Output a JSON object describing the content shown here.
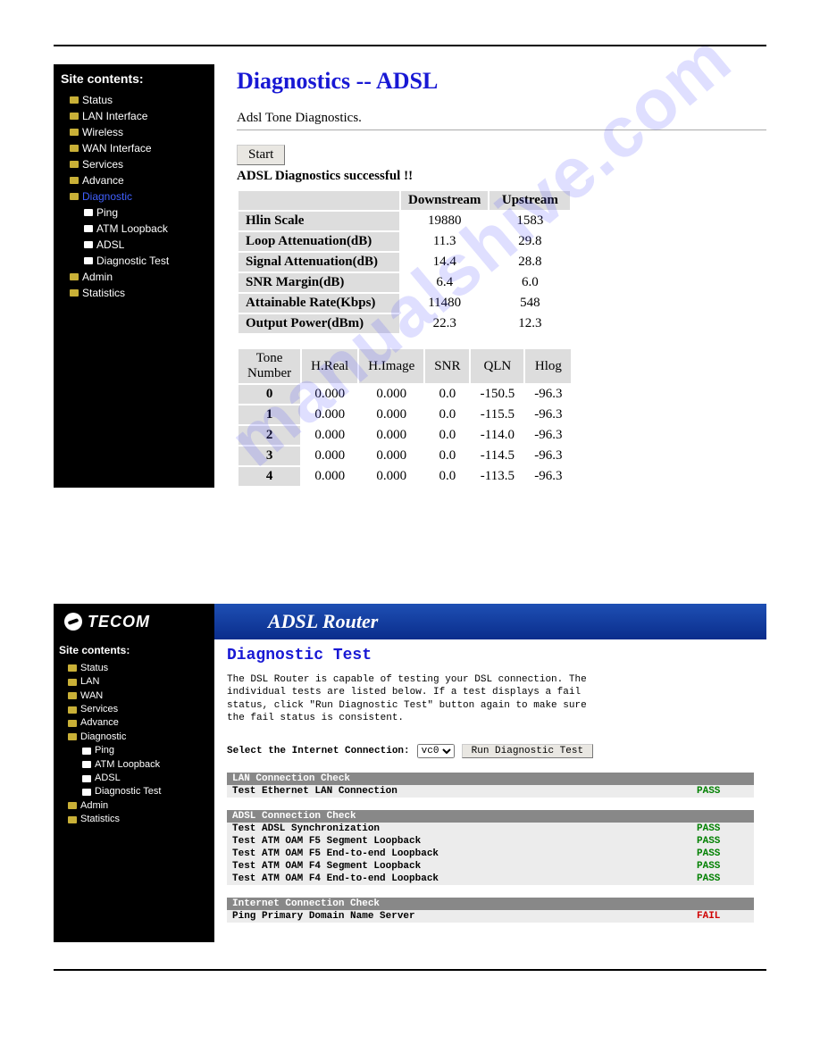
{
  "watermark": "manualshive.com",
  "panel1": {
    "page_title": "Diagnostics -- ADSL",
    "subtitle": "Adsl Tone Diagnostics.",
    "start_btn": "Start",
    "success_msg": "ADSL Diagnostics successful !!",
    "sidebar": {
      "title": "Site contents:",
      "items": [
        {
          "label": "Status",
          "type": "folder",
          "level": 1
        },
        {
          "label": "LAN Interface",
          "type": "folder",
          "level": 1
        },
        {
          "label": "Wireless",
          "type": "folder",
          "level": 1
        },
        {
          "label": "WAN Interface",
          "type": "folder",
          "level": 1
        },
        {
          "label": "Services",
          "type": "folder",
          "level": 1
        },
        {
          "label": "Advance",
          "type": "folder",
          "level": 1
        },
        {
          "label": "Diagnostic",
          "type": "folder",
          "level": 1,
          "active": true
        },
        {
          "label": "Ping",
          "type": "page",
          "level": 2
        },
        {
          "label": "ATM Loopback",
          "type": "page",
          "level": 2
        },
        {
          "label": "ADSL",
          "type": "page",
          "level": 2
        },
        {
          "label": "Diagnostic Test",
          "type": "page",
          "level": 2
        },
        {
          "label": "Admin",
          "type": "folder",
          "level": 1
        },
        {
          "label": "Statistics",
          "type": "folder",
          "level": 1
        }
      ]
    },
    "diag_table": {
      "col1": "Downstream",
      "col2": "Upstream",
      "rows": [
        {
          "label": "Hlin Scale",
          "down": "19880",
          "up": "1583"
        },
        {
          "label": "Loop Attenuation(dB)",
          "down": "11.3",
          "up": "29.8"
        },
        {
          "label": "Signal Attenuation(dB)",
          "down": "14.4",
          "up": "28.8"
        },
        {
          "label": "SNR Margin(dB)",
          "down": "6.4",
          "up": "6.0"
        },
        {
          "label": "Attainable Rate(Kbps)",
          "down": "11480",
          "up": "548"
        },
        {
          "label": "Output Power(dBm)",
          "down": "22.3",
          "up": "12.3"
        }
      ]
    },
    "tone_table": {
      "headers": [
        "Tone Number",
        "H.Real",
        "H.Image",
        "SNR",
        "QLN",
        "Hlog"
      ],
      "rows": [
        {
          "n": "0",
          "hreal": "0.000",
          "himage": "0.000",
          "snr": "0.0",
          "qln": "-150.5",
          "hlog": "-96.3"
        },
        {
          "n": "1",
          "hreal": "0.000",
          "himage": "0.000",
          "snr": "0.0",
          "qln": "-115.5",
          "hlog": "-96.3"
        },
        {
          "n": "2",
          "hreal": "0.000",
          "himage": "0.000",
          "snr": "0.0",
          "qln": "-114.0",
          "hlog": "-96.3"
        },
        {
          "n": "3",
          "hreal": "0.000",
          "himage": "0.000",
          "snr": "0.0",
          "qln": "-114.5",
          "hlog": "-96.3"
        },
        {
          "n": "4",
          "hreal": "0.000",
          "himage": "0.000",
          "snr": "0.0",
          "qln": "-113.5",
          "hlog": "-96.3"
        }
      ]
    }
  },
  "panel2": {
    "brand": "TECOM",
    "banner": "ADSL Router",
    "page_title": "Diagnostic Test",
    "desc": "The DSL Router is capable of testing your DSL connection. The individual tests are listed below. If a test displays a fail status, click \"Run Diagnostic Test\" button again to make sure the fail status is consistent.",
    "select_label": "Select the Internet Connection:",
    "select_value": "vc0",
    "run_btn": "Run Diagnostic Test",
    "sidebar": {
      "title": "Site contents:",
      "items": [
        {
          "label": "Status",
          "type": "folder",
          "level": 1
        },
        {
          "label": "LAN",
          "type": "folder",
          "level": 1
        },
        {
          "label": "WAN",
          "type": "folder",
          "level": 1
        },
        {
          "label": "Services",
          "type": "folder",
          "level": 1
        },
        {
          "label": "Advance",
          "type": "folder",
          "level": 1
        },
        {
          "label": "Diagnostic",
          "type": "folder",
          "level": 1
        },
        {
          "label": "Ping",
          "type": "page",
          "level": 2
        },
        {
          "label": "ATM Loopback",
          "type": "page",
          "level": 2
        },
        {
          "label": "ADSL",
          "type": "page",
          "level": 2
        },
        {
          "label": "Diagnostic Test",
          "type": "page",
          "level": 2
        },
        {
          "label": "Admin",
          "type": "folder",
          "level": 1
        },
        {
          "label": "Statistics",
          "type": "folder",
          "level": 1
        }
      ]
    },
    "checks": [
      {
        "title": "LAN Connection Check",
        "rows": [
          {
            "label": "Test Ethernet LAN Connection",
            "result": "PASS"
          }
        ]
      },
      {
        "title": "ADSL Connection Check",
        "rows": [
          {
            "label": "Test ADSL Synchronization",
            "result": "PASS"
          },
          {
            "label": "Test ATM OAM F5 Segment Loopback",
            "result": "PASS"
          },
          {
            "label": "Test ATM OAM F5 End-to-end Loopback",
            "result": "PASS"
          },
          {
            "label": "Test ATM OAM F4 Segment Loopback",
            "result": "PASS"
          },
          {
            "label": "Test ATM OAM F4 End-to-end Loopback",
            "result": "PASS"
          }
        ]
      },
      {
        "title": "Internet Connection Check",
        "rows": [
          {
            "label": "Ping Primary Domain Name Server",
            "result": "FAIL"
          }
        ]
      }
    ]
  }
}
